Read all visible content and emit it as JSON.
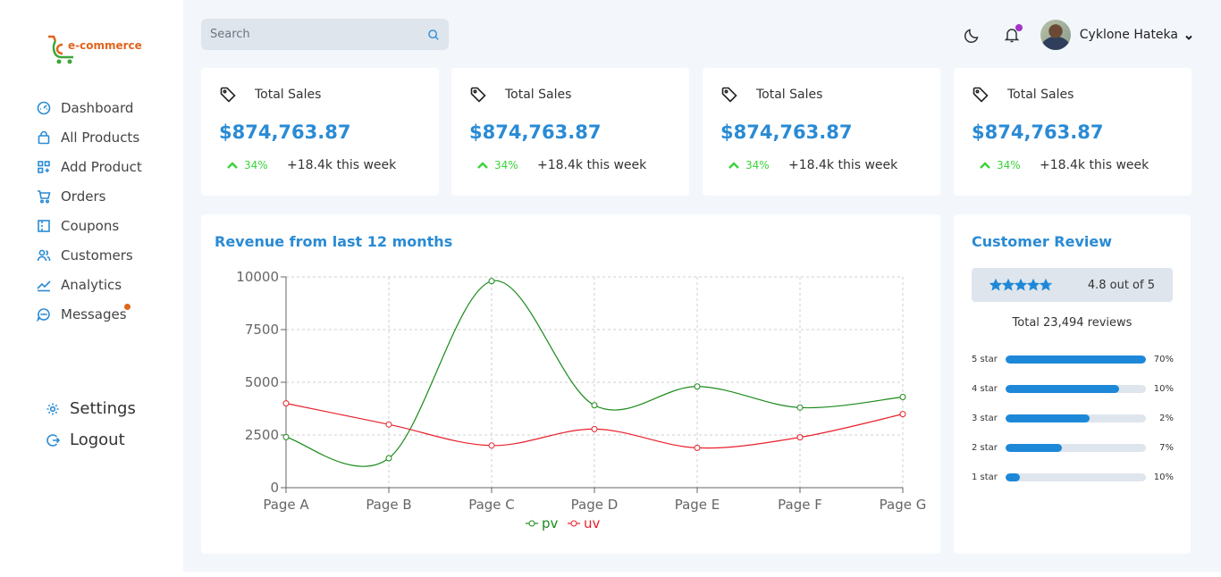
{
  "brand": {
    "logo_text": "e-commerce",
    "accent": "#2a8bd4",
    "logo_color": "#e0651f"
  },
  "sidebar": {
    "items": [
      {
        "label": "Dashboard",
        "icon": "gauge-icon"
      },
      {
        "label": "All Products",
        "icon": "bag-icon"
      },
      {
        "label": "Add Product",
        "icon": "grid-plus-icon"
      },
      {
        "label": "Orders",
        "icon": "cart-icon"
      },
      {
        "label": "Coupons",
        "icon": "coupon-icon"
      },
      {
        "label": "Customers",
        "icon": "users-icon"
      },
      {
        "label": "Analytics",
        "icon": "trend-icon"
      },
      {
        "label": "Messages",
        "icon": "chat-icon",
        "has_badge": true
      }
    ],
    "settings_label": "Settings",
    "logout_label": "Logout"
  },
  "header": {
    "search_placeholder": "Search",
    "user_name": "Cyklone Hateka"
  },
  "stats": [
    {
      "title": "Total Sales",
      "value": "$874,763.87",
      "pct": "34%",
      "week": "+18.4k this week"
    },
    {
      "title": "Total Sales",
      "value": "$874,763.87",
      "pct": "34%",
      "week": "+18.4k this week"
    },
    {
      "title": "Total Sales",
      "value": "$874,763.87",
      "pct": "34%",
      "week": "+18.4k this week"
    },
    {
      "title": "Total Sales",
      "value": "$874,763.87",
      "pct": "34%",
      "week": "+18.4k this week"
    }
  ],
  "revenue": {
    "title": "Revenue from last 12 months"
  },
  "chart_data": {
    "type": "line",
    "categories": [
      "Page A",
      "Page B",
      "Page C",
      "Page D",
      "Page E",
      "Page F",
      "Page G"
    ],
    "series": [
      {
        "name": "pv",
        "color": "#1a8a1a",
        "values": [
          2400,
          1398,
          9800,
          3908,
          4800,
          3800,
          4300
        ]
      },
      {
        "name": "uv",
        "color": "#e8202a",
        "values": [
          4000,
          3000,
          2000,
          2780,
          1890,
          2390,
          3490
        ]
      }
    ],
    "yticks": [
      "0",
      "2500",
      "5000",
      "7500",
      "10000"
    ],
    "ylim": [
      0,
      10000
    ],
    "grid": true,
    "legend": "bottom"
  },
  "review": {
    "title": "Customer Review",
    "rating_text": "4.8 out of 5",
    "rating": 4.8,
    "total": "Total 23,494 reviews",
    "distribution": [
      {
        "label": "5 star",
        "pct": "70%",
        "fill": 1.0
      },
      {
        "label": "4 star",
        "pct": "10%",
        "fill": 0.81
      },
      {
        "label": "3 star",
        "pct": "2%",
        "fill": 0.6
      },
      {
        "label": "2 star",
        "pct": "7%",
        "fill": 0.4
      },
      {
        "label": "1 star",
        "pct": "10%",
        "fill": 0.1
      }
    ]
  }
}
